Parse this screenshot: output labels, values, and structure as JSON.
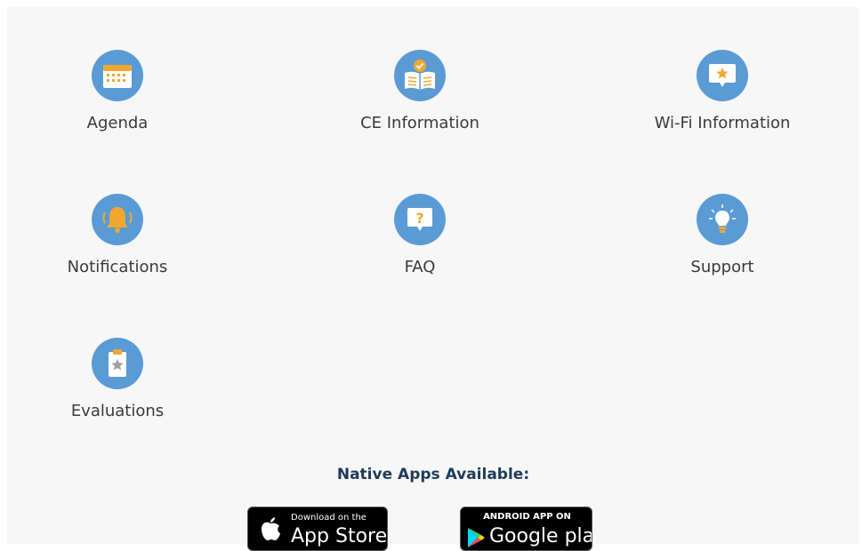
{
  "menu": {
    "items": [
      {
        "label": "Agenda",
        "icon": "calendar-icon"
      },
      {
        "label": "CE Information",
        "icon": "open-book-check-icon"
      },
      {
        "label": "Wi-Fi Information",
        "icon": "screen-star-icon"
      },
      {
        "label": "Notifications",
        "icon": "bell-icon"
      },
      {
        "label": "FAQ",
        "icon": "question-bubble-icon"
      },
      {
        "label": "Support",
        "icon": "lightbulb-icon"
      },
      {
        "label": "Evaluations",
        "icon": "clipboard-star-icon"
      }
    ]
  },
  "apps": {
    "title": "Native Apps Available:",
    "app_store": {
      "small": "Download on the",
      "big": "App Store"
    },
    "google_play": {
      "small": "ANDROID APP ON",
      "big": "Google play"
    }
  },
  "colors": {
    "icon_circle": "#5b9bd5",
    "accent_orange": "#f0a830",
    "panel_background": "#f7f7f7",
    "heading": "#1f3b57"
  }
}
